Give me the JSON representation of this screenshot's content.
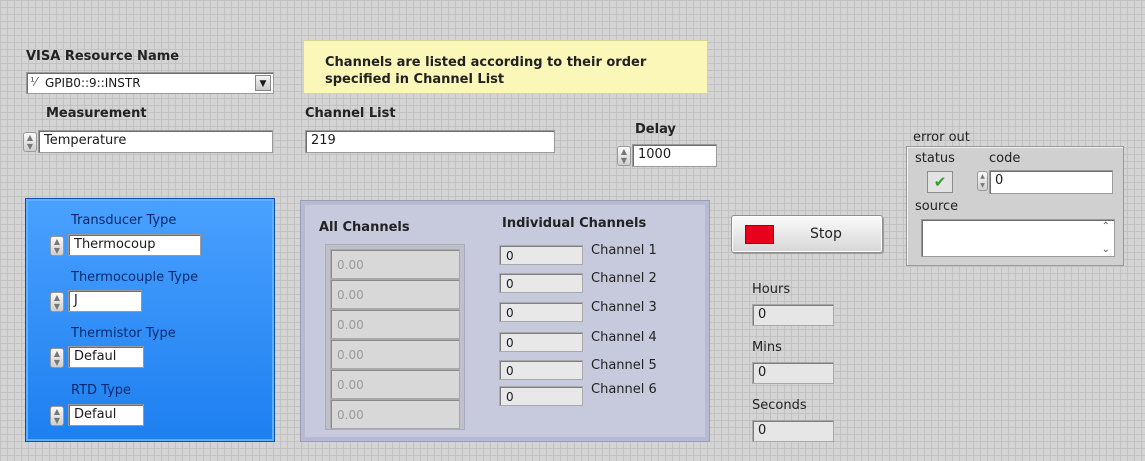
{
  "visa": {
    "label": "VISA Resource Name",
    "value": "GPIB0::9::INSTR"
  },
  "note": {
    "text": "Channels are listed according to their order specified in Channel List"
  },
  "measurement": {
    "label": "Measurement",
    "value": "Temperature"
  },
  "channel_list": {
    "label": "Channel List",
    "value": "219"
  },
  "delay": {
    "label": "Delay",
    "value": "1000"
  },
  "error_out": {
    "label": "error out",
    "status_label": "status",
    "code_label": "code",
    "code_value": "0",
    "source_label": "source",
    "source_value": ""
  },
  "transducer": {
    "transducer_type": {
      "label": "Transducer Type",
      "value": "Thermocoup"
    },
    "thermocouple_type": {
      "label": "Thermocouple Type",
      "value": "J"
    },
    "thermistor_type": {
      "label": "Thermistor Type",
      "value": "Defaul"
    },
    "rtd_type": {
      "label": "RTD Type",
      "value": "Defaul"
    }
  },
  "all_channels": {
    "label": "All Channels",
    "values": [
      "0.00",
      "0.00",
      "0.00",
      "0.00",
      "0.00",
      "0.00"
    ]
  },
  "individual_channels": {
    "label": "Individual Channels",
    "items": [
      {
        "value": "0",
        "label": "Channel 1"
      },
      {
        "value": "0",
        "label": "Channel 2"
      },
      {
        "value": "0",
        "label": "Channel 3"
      },
      {
        "value": "0",
        "label": "Channel 4"
      },
      {
        "value": "0",
        "label": "Channel 5"
      },
      {
        "value": "0",
        "label": "Channel 6"
      }
    ]
  },
  "stop_button": {
    "label": "Stop",
    "color": "#e8001c"
  },
  "timer": {
    "hours_label": "Hours",
    "hours_value": "0",
    "mins_label": "Mins",
    "mins_value": "0",
    "seconds_label": "Seconds",
    "seconds_value": "0"
  },
  "colors": {
    "panel_blue": "#1d7ff0",
    "panel_lavender": "#c7c9dd",
    "note_bg": "#fbf7b8",
    "status_ok": "#2ea12e"
  }
}
